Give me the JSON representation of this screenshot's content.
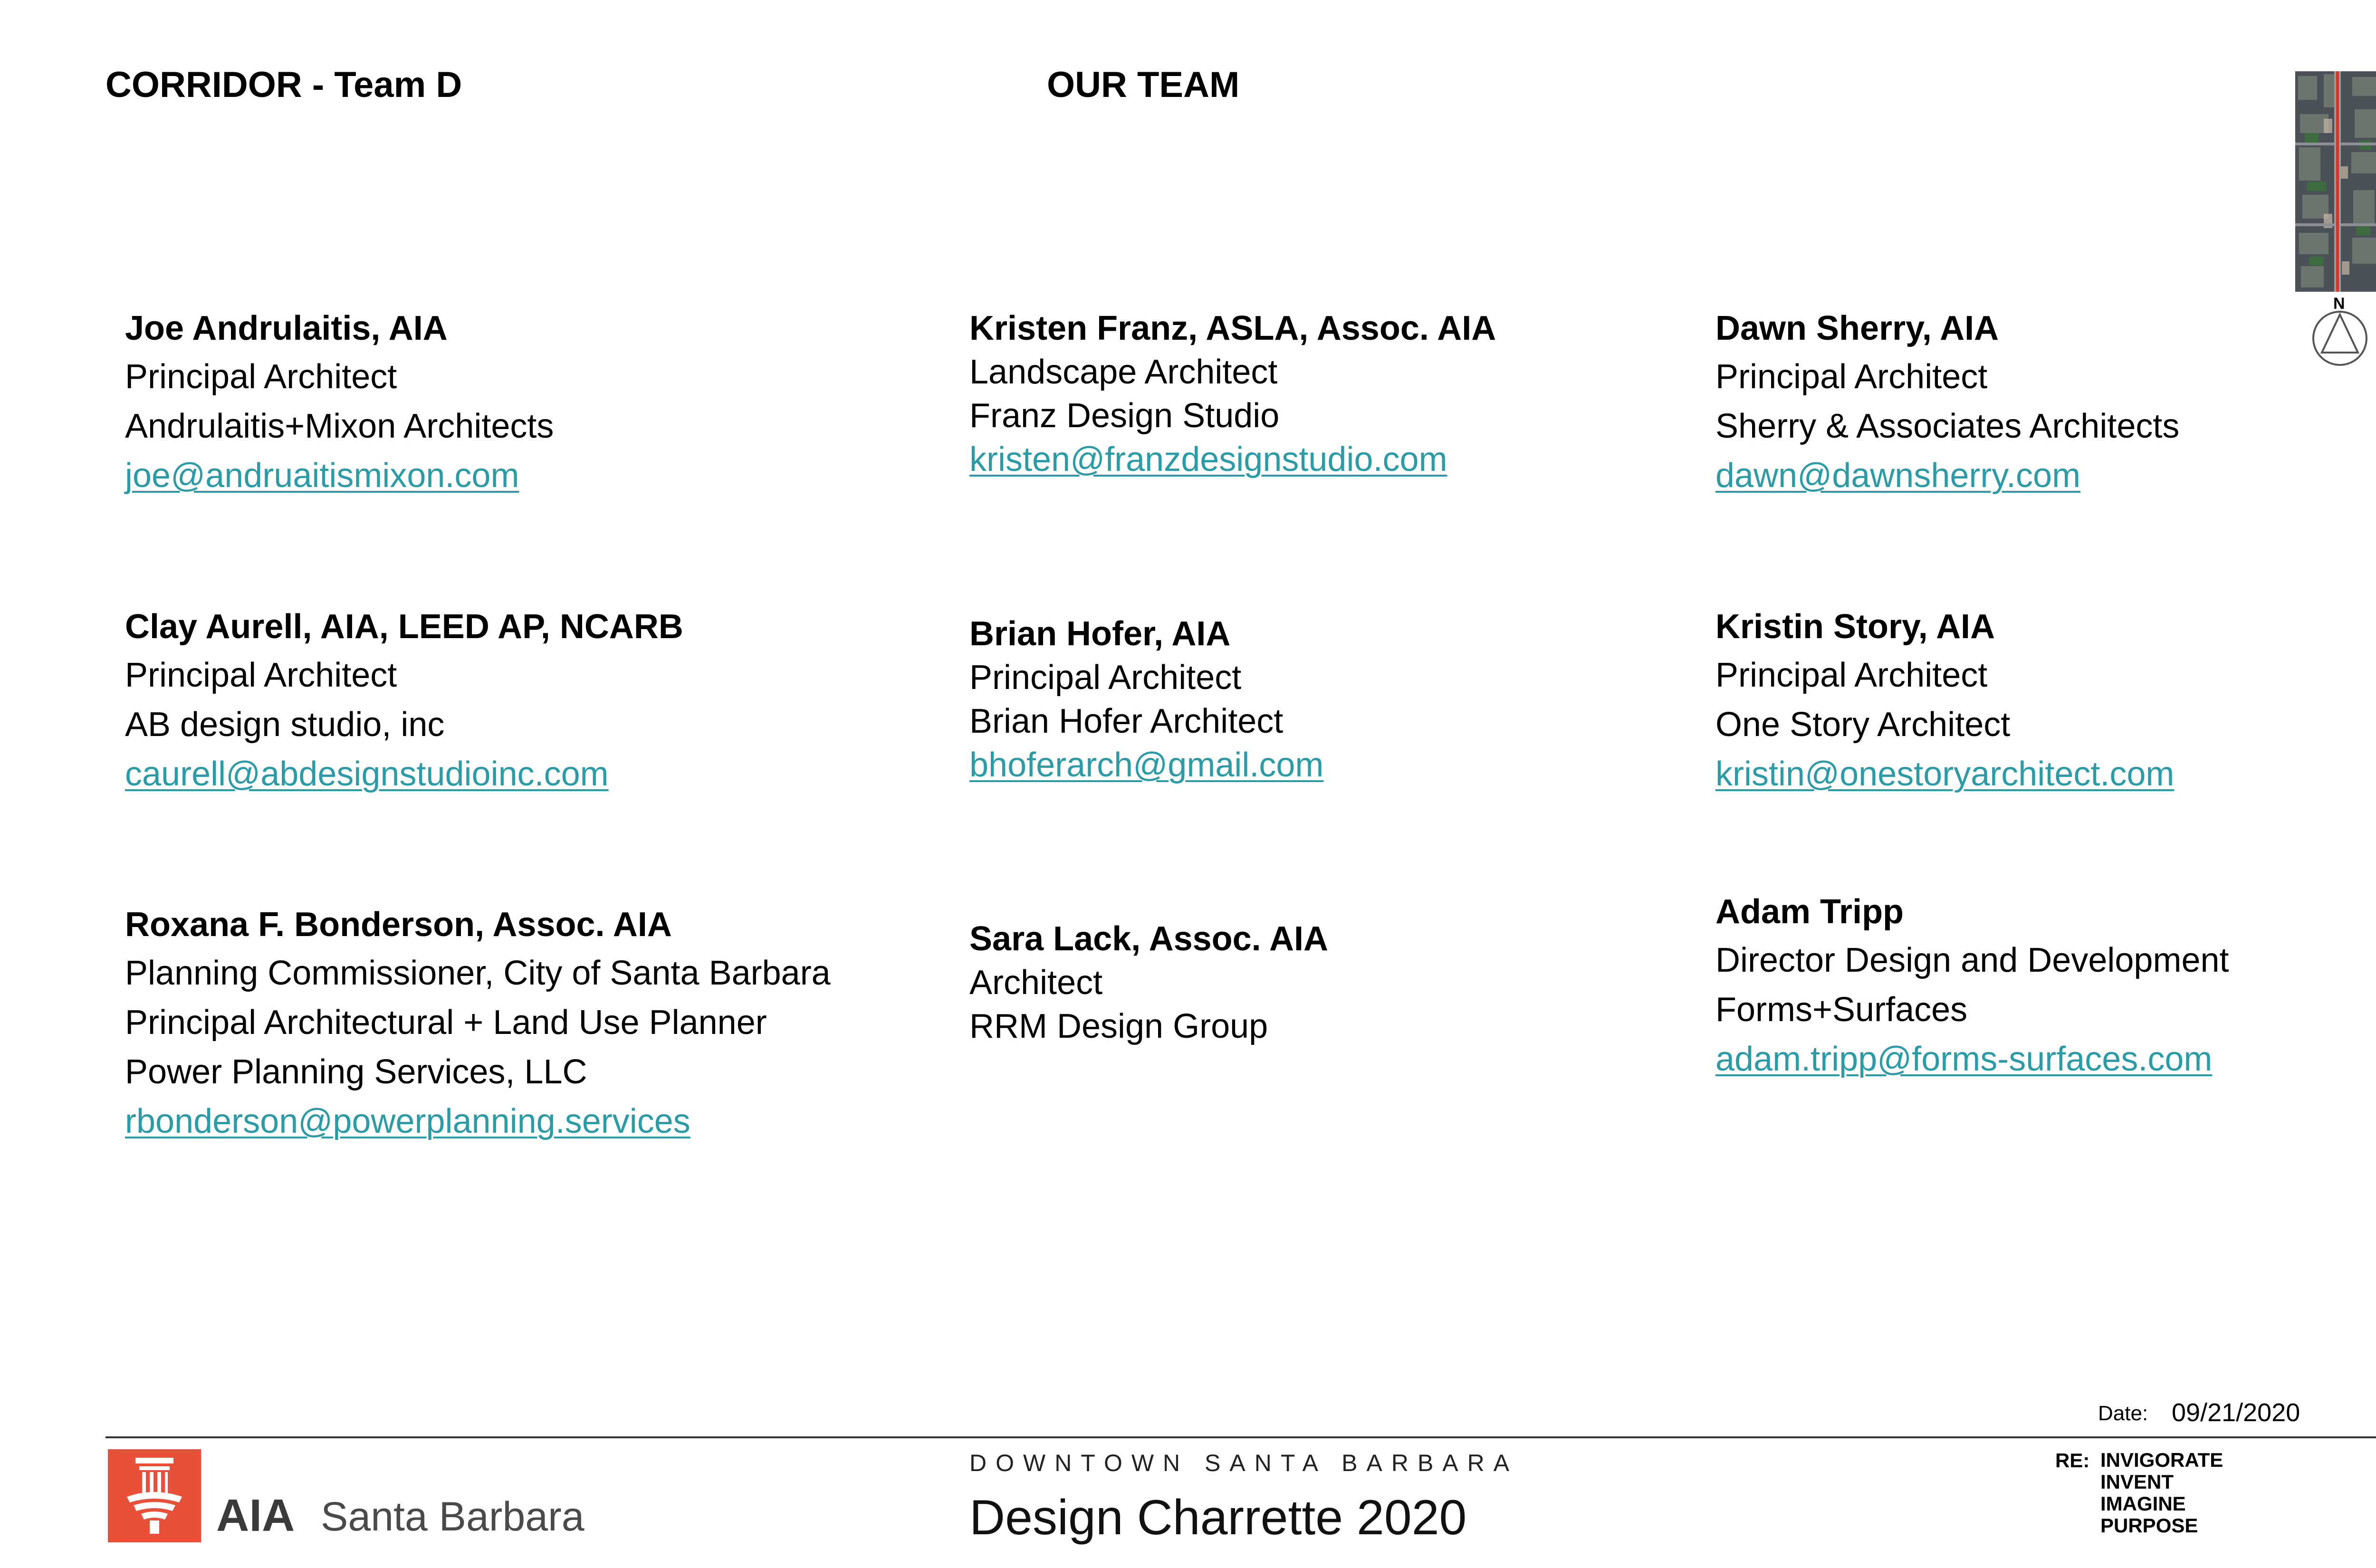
{
  "header": {
    "corridor_title": "CORRIDOR - Team D",
    "section_title": "OUR TEAM"
  },
  "team": [
    {
      "name": "Joe Andrulaitis, AIA",
      "lines": [
        "Principal Architect",
        "Andrulaitis+Mixon Architects"
      ],
      "email": "joe@andruaitismixon.com"
    },
    {
      "name": "Kristen Franz, ASLA, Assoc. AIA",
      "lines": [
        "Landscape Architect",
        "Franz Design Studio"
      ],
      "email": "kristen@franzdesignstudio.com"
    },
    {
      "name": "Dawn Sherry, AIA",
      "lines": [
        "Principal Architect",
        "Sherry & Associates Architects"
      ],
      "email": "dawn@dawnsherry.com"
    },
    {
      "name": "Clay Aurell, AIA, LEED AP, NCARB",
      "lines": [
        "Principal Architect",
        "AB design studio, inc"
      ],
      "email": "caurell@abdesignstudioinc.com"
    },
    {
      "name": "Brian Hofer, AIA",
      "lines": [
        "Principal Architect",
        "Brian Hofer Architect"
      ],
      "email": "bhoferarch@gmail.com"
    },
    {
      "name": "Kristin Story, AIA",
      "lines": [
        "Principal Architect",
        "One Story Architect"
      ],
      "email": "kristin@onestoryarchitect.com"
    },
    {
      "name": "Roxana F. Bonderson, Assoc. AIA",
      "lines": [
        "Planning Commissioner, City of Santa Barbara",
        "Principal Architectural + Land Use Planner",
        "Power Planning Services, LLC"
      ],
      "email": "rbonderson@powerplanning.services"
    },
    {
      "name": "Sara Lack, Assoc. AIA",
      "lines": [
        "Architect",
        "RRM Design Group"
      ],
      "email": ""
    },
    {
      "name": "Adam Tripp",
      "lines": [
        "Director Design and Development",
        "Forms+Surfaces"
      ],
      "email": "adam.tripp@forms-surfaces.com"
    }
  ],
  "key_map": {
    "north_label": "N",
    "icon": "north-arrow-icon"
  },
  "footer": {
    "date_label": "Date:",
    "date_value": "09/21/2020",
    "org_mark": "AIA",
    "org_city": "Santa Barbara",
    "program_location": "DOWNTOWN SANTA BARBARA",
    "program_title": "Design Charrette 2020",
    "re_label": "RE:",
    "re_items": [
      "INVIGORATE",
      "INVENT",
      "IMAGINE",
      "PURPOSE"
    ]
  },
  "colors": {
    "link": "#2b9ca6",
    "aia_red": "#e8503a",
    "map_route": "#e0302a"
  }
}
